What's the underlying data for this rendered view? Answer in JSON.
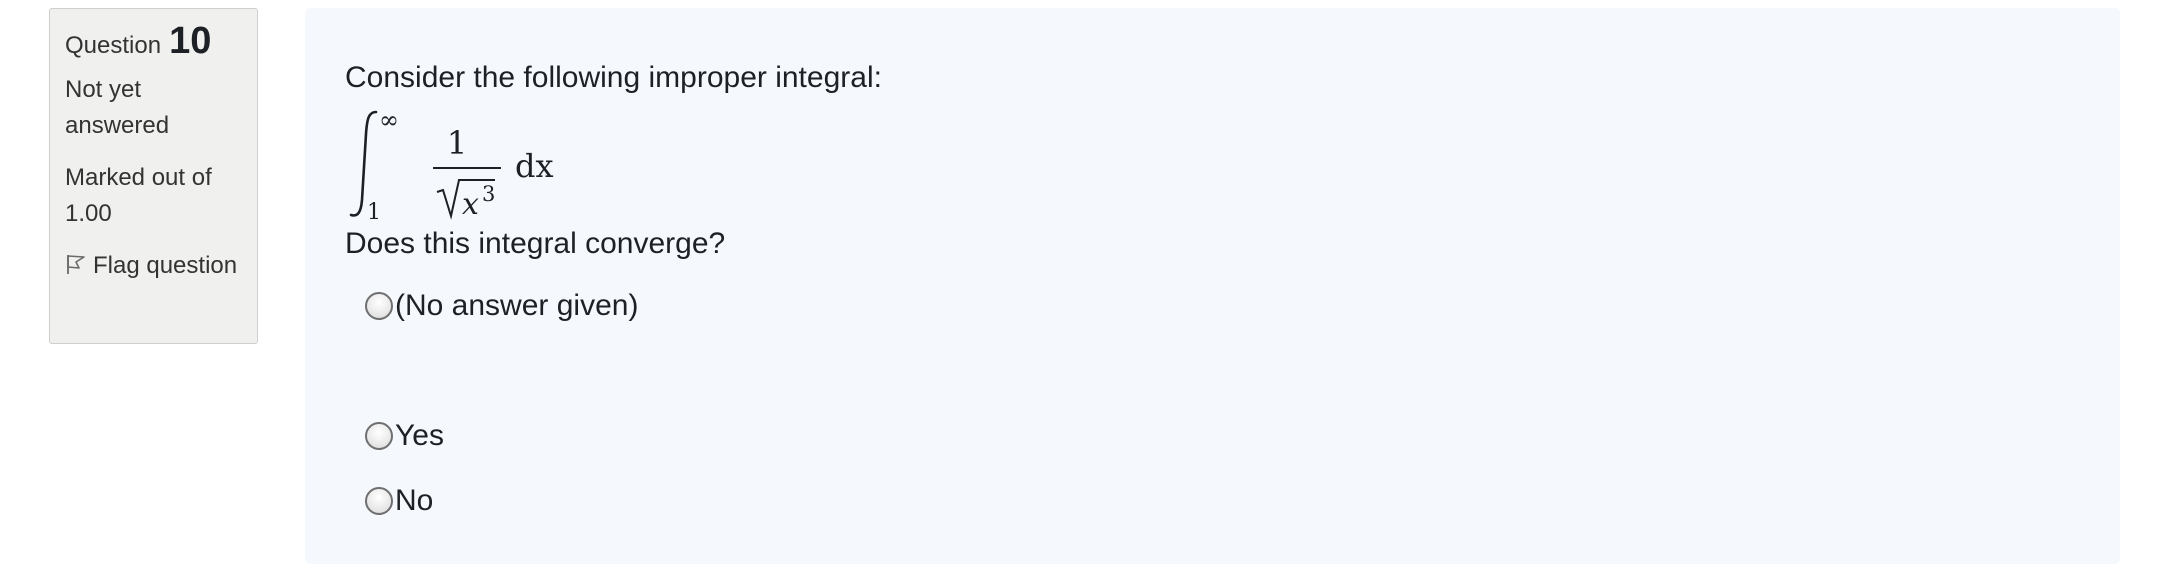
{
  "info": {
    "question_label": "Question",
    "question_number": "10",
    "state": "Not yet answered",
    "grade_label": "Marked out of 1.00",
    "flag_label": "Flag question",
    "flag_icon": "flag-icon"
  },
  "question": {
    "intro": "Consider the following improper integral:",
    "integral": {
      "lower": "1",
      "upper": "∞",
      "numerator": "1",
      "denominator_base": "x",
      "denominator_exponent": "3",
      "differential": "dx"
    },
    "prompt": "Does this integral converge?"
  },
  "answers": [
    {
      "label": "(No answer given)",
      "selected": false
    },
    {
      "label": "Yes",
      "selected": false
    },
    {
      "label": "No",
      "selected": false
    }
  ]
}
